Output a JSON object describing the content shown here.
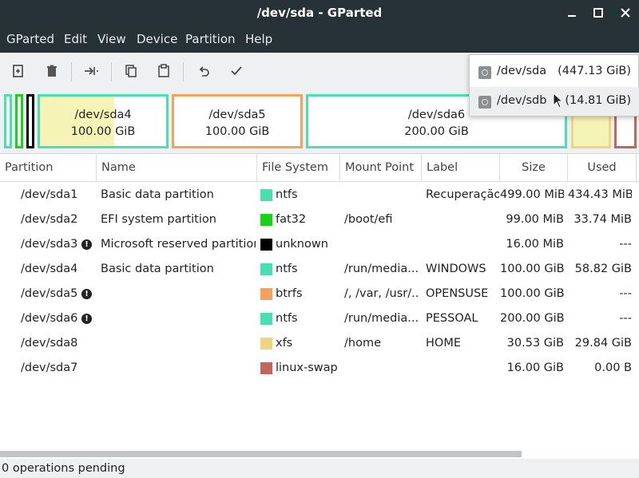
{
  "window": {
    "title": "/dev/sda - GParted"
  },
  "menu": [
    "GParted",
    "Edit",
    "View",
    "Device",
    "Partition",
    "Help"
  ],
  "toolbar": [
    "new-icon",
    "delete-icon",
    "resize-move-icon",
    "copy-icon",
    "paste-icon",
    "undo-icon",
    "apply-icon"
  ],
  "diskmap": {
    "partitions": [
      {
        "name": "/dev/sda4",
        "size": "100.00 GiB",
        "color": "#48e0b0",
        "used_fraction": 0.588
      },
      {
        "name": "/dev/sda5",
        "size": "100.00 GiB",
        "color": "#f7a05b",
        "used_fraction": 0
      },
      {
        "name": "/dev/sda6",
        "size": "200.00 GiB",
        "color": "#48e0b0",
        "used_fraction": 0
      }
    ]
  },
  "table": {
    "columns": [
      "Partition",
      "Name",
      "File System",
      "Mount Point",
      "Label",
      "Size",
      "Used"
    ],
    "rows": [
      {
        "partition": "/dev/sda1",
        "warn": false,
        "name": "Basic data partition",
        "fs": "ntfs",
        "fs_color": "#48e0b0",
        "mount": "",
        "label": "Recuperação",
        "size": "499.00 MiB",
        "used": "434.43 MiB"
      },
      {
        "partition": "/dev/sda2",
        "warn": false,
        "name": "EFI system partition",
        "fs": "fat32",
        "fs_color": "#18d418",
        "mount": "/boot/efi",
        "label": "",
        "size": "99.00 MiB",
        "used": "33.74 MiB"
      },
      {
        "partition": "/dev/sda3",
        "warn": true,
        "name": "Microsoft reserved partition",
        "fs": "unknown",
        "fs_color": "#000000",
        "mount": "",
        "label": "",
        "size": "16.00 MiB",
        "used": "---"
      },
      {
        "partition": "/dev/sda4",
        "warn": false,
        "name": "Basic data partition",
        "fs": "ntfs",
        "fs_color": "#48e0b0",
        "mount": "/run/media...",
        "label": "WINDOWS",
        "size": "100.00 GiB",
        "used": "58.82 GiB"
      },
      {
        "partition": "/dev/sda5",
        "warn": true,
        "name": "",
        "fs": "btrfs",
        "fs_color": "#f7a05b",
        "mount": "/, /var, /usr/...",
        "label": "OPENSUSE",
        "size": "100.00 GiB",
        "used": "---"
      },
      {
        "partition": "/dev/sda6",
        "warn": true,
        "name": "",
        "fs": "ntfs",
        "fs_color": "#48e0b0",
        "mount": "/run/media...",
        "label": "PESSOAL",
        "size": "200.00 GiB",
        "used": "---"
      },
      {
        "partition": "/dev/sda8",
        "warn": false,
        "name": "",
        "fs": "xfs",
        "fs_color": "#eed680",
        "mount": "/home",
        "label": "HOME",
        "size": "30.53 GiB",
        "used": "29.84 GiB"
      },
      {
        "partition": "/dev/sda7",
        "warn": false,
        "name": "",
        "fs": "linux-swap",
        "fs_color": "#c1665a",
        "mount": "",
        "label": "",
        "size": "16.00 GiB",
        "used": "0.00 B"
      }
    ]
  },
  "status": {
    "text": "0 operations pending"
  },
  "device_popup": {
    "items": [
      {
        "name": "/dev/sda",
        "size": "(447.13 GiB)"
      },
      {
        "name": "/dev/sdb",
        "size": "(14.81 GiB)"
      }
    ]
  }
}
